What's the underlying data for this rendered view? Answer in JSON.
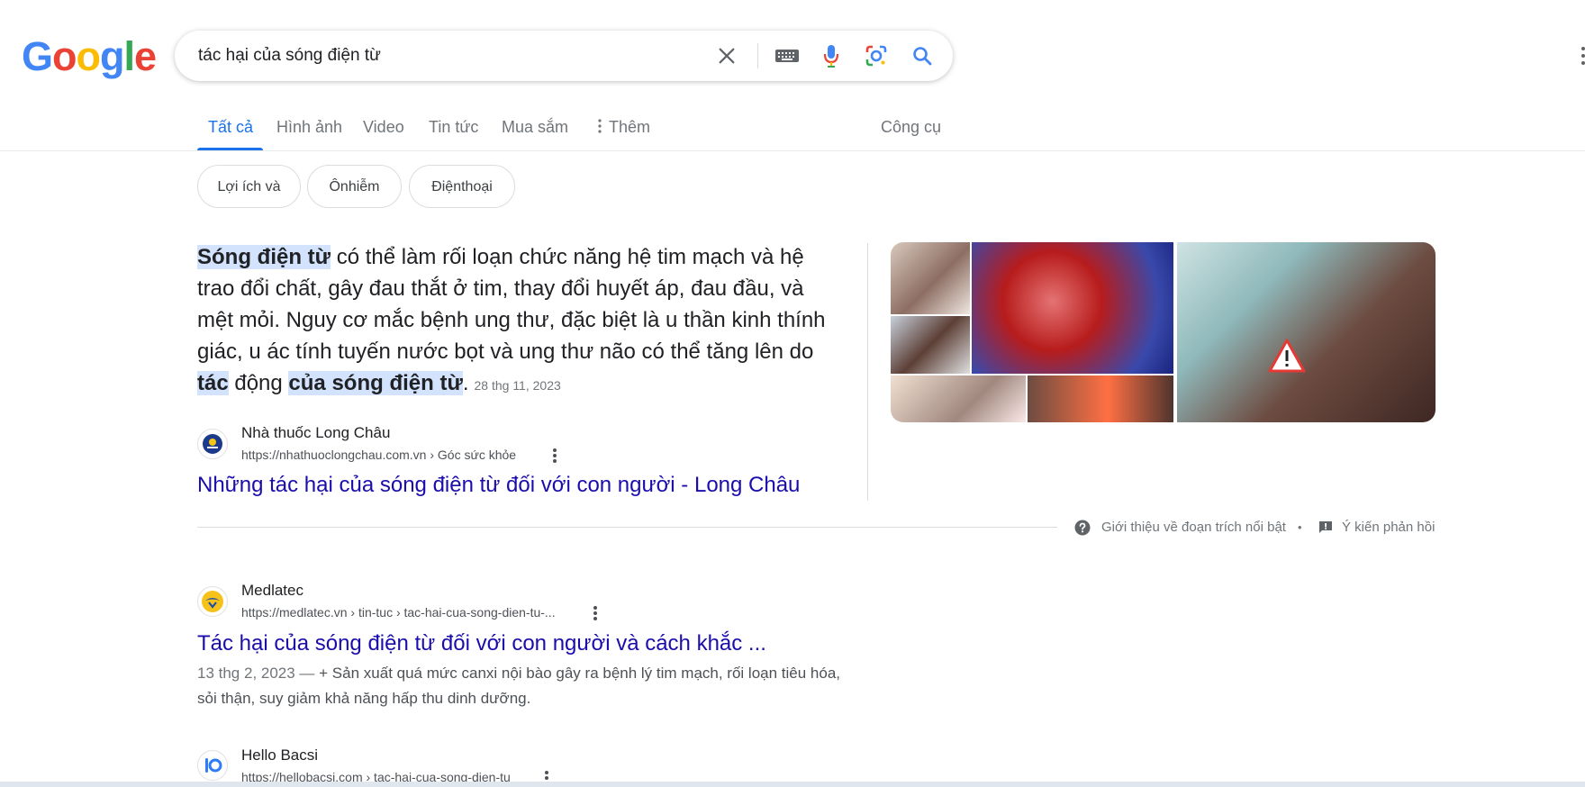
{
  "logo": {
    "letters": [
      "G",
      "o",
      "o",
      "g",
      "l",
      "e"
    ],
    "colors": [
      "#4285F4",
      "#EA4335",
      "#FBBC05",
      "#4285F4",
      "#34A853",
      "#EA4335"
    ]
  },
  "search": {
    "query": "tác hại của sóng điện từ"
  },
  "tabs": {
    "all": "Tất cả",
    "images": "Hình ảnh",
    "video": "Video",
    "news": "Tin tức",
    "shopping": "Mua sắm",
    "more": "Thêm",
    "tools": "Công cụ"
  },
  "chips": [
    "Lợi ích và",
    "Ônhiễm",
    "Điệnthoại"
  ],
  "snippet": {
    "t1": "Sóng điện từ",
    "t2": " có thể làm rối loạn chức năng hệ tim mạch và hệ trao đổi chất, gây đau thắt ở tim, thay đổi huyết áp, đau đầu, và mệt mỏi. Nguy cơ mắc bệnh ung thư, đặc biệt là u thần kinh thính giác, u ác tính tuyến nước bọt và ung thư não có thể tăng lên do ",
    "t3": "tác",
    "t4": " động ",
    "t5": "của sóng điện từ",
    "t6": ".",
    "date": "28 thg 11, 2023",
    "site_name": "Nhà thuốc Long Châu",
    "site_url": "https://nhathuoclongchau.com.vn › Góc sức khỏe",
    "title": "Những tác hại của sóng điện từ đối với con người - Long Châu",
    "footer_about": "Giới thiệu về đoạn trích nổi bật",
    "footer_sep": "•",
    "footer_feedback": "Ý kiến phản hồi"
  },
  "results": [
    {
      "site_name": "Medlatec",
      "site_url": "https://medlatec.vn › tin-tuc › tac-hai-cua-song-dien-tu-...",
      "title": "Tác hại của sóng điện từ đối với con người và cách khắc ...",
      "date": "13 thg 2, 2023 —",
      "desc": " + Sản xuất quá mức canxi nội bào gây ra bệnh lý tim mạch, rối loạn tiêu hóa, sỏi thận, suy giảm khả năng hấp thu dinh dưỡng."
    },
    {
      "site_name": "Hello Bacsi",
      "site_url": "https://hellobacsi.com › tac-hai-cua-song-dien-tu"
    }
  ],
  "colors": {
    "link": "#1a0dab",
    "accent": "#1a73e8",
    "highlight": "#d3e3fd"
  }
}
